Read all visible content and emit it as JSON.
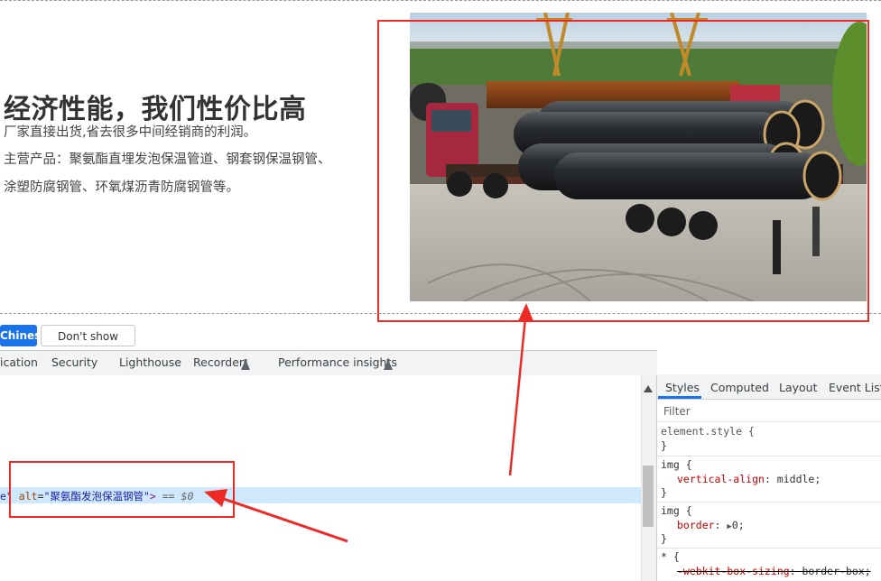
{
  "page": {
    "headline": "经济性能，我们性价比高",
    "lines": [
      "厂家直接出货,省去很多中间经销商的利润。",
      "主营产品：聚氨酯直埋发泡保温管道、钢套钢保温钢管、",
      "涂塑防腐钢管、环氧煤沥青防腐钢管等。"
    ]
  },
  "translate_bar": {
    "primary": "Chinese",
    "secondary": "Don't show again"
  },
  "devtools": {
    "tabs": [
      "ication",
      "Security",
      "Lighthouse",
      "Recorder",
      "Performance insights"
    ],
    "selected_node": {
      "prefix": "e\"",
      "attr": "alt",
      "eq": "=",
      "value": "\"聚氨酯发泡保温钢管\"",
      "close": ">",
      "suffix": "== $0"
    },
    "styles_tabs": [
      "Styles",
      "Computed",
      "Layout",
      "Event Listen"
    ],
    "filter_placeholder": "Filter",
    "rules": [
      {
        "selector": "element.style {",
        "decl": "",
        "close": "}"
      },
      {
        "selector": "img {",
        "prop": "vertical-align",
        "val": "middle;",
        "close": "}"
      },
      {
        "selector": "img {",
        "prop": "border",
        "val": "0;",
        "close": "}"
      },
      {
        "selector": "* {",
        "prop": "-webkit-box-sizing",
        "val": "border-box;",
        "close": ""
      }
    ]
  },
  "colors": {
    "annotation_red": "#ee2a24",
    "selection_blue": "#cfe8fc",
    "primary_button": "#1a73e8"
  },
  "icons": {
    "flask": "flask-icon",
    "expand": "triangle-right-icon",
    "scroll_up": "scroll-up-arrow-icon"
  }
}
